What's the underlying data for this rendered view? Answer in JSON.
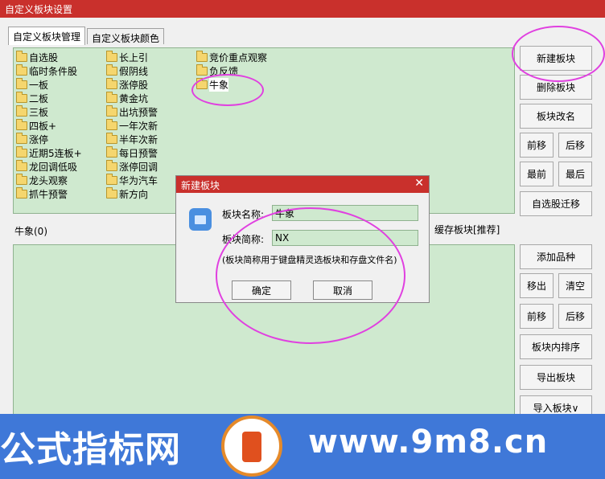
{
  "window": {
    "title": "自定义板块设置"
  },
  "tabs": [
    {
      "label": "自定义板块管理"
    },
    {
      "label": "自定义板块颜色"
    }
  ],
  "blocks": {
    "col1": [
      "自选股",
      "临时条件股",
      "一板",
      "二板",
      "三板",
      "四板+",
      "涨停",
      "近期5连板+",
      "龙回调低吸",
      "龙头观察",
      "抓牛预警"
    ],
    "col2": [
      "长上引",
      "假阴线",
      "涨停股",
      "黄金坑",
      "出坑预警",
      "一年次新",
      "半年次新",
      "每日预警",
      "涨停回调",
      "华为汽车",
      "新方向"
    ],
    "col3": [
      "竞价重点观察",
      "负反馈",
      "牛象"
    ]
  },
  "selected_block_label": "牛象(0)",
  "cache_label": "缓存板块[推荐]",
  "buttons": {
    "new_block": "新建板块",
    "delete_block": "删除板块",
    "rename_block": "板块改名",
    "move_up": "前移",
    "move_down": "后移",
    "move_first": "最前",
    "move_last": "最后",
    "migrate": "自选股迁移",
    "add_item": "添加品种",
    "remove": "移出",
    "clear": "清空",
    "move_up2": "前移",
    "move_down2": "后移",
    "sort_inside": "板块内排序",
    "export": "导出板块",
    "import": "导入板块∨"
  },
  "dialog": {
    "title": "新建板块",
    "name_label": "板块名称:",
    "name_value": "牛象",
    "abbr_label": "板块简称:",
    "abbr_value": "NX",
    "note": "(板块简称用于键盘精灵选板块和存盘文件名)",
    "ok": "确定",
    "cancel": "取消",
    "close": "✕"
  },
  "watermark": {
    "left": "公式指标网",
    "right": "www.9m8.cn"
  },
  "colors": {
    "titlebar": "#c9302c",
    "panel": "#cfe9cf",
    "annotation": "#e040e0",
    "banner": "#3f78d8"
  }
}
